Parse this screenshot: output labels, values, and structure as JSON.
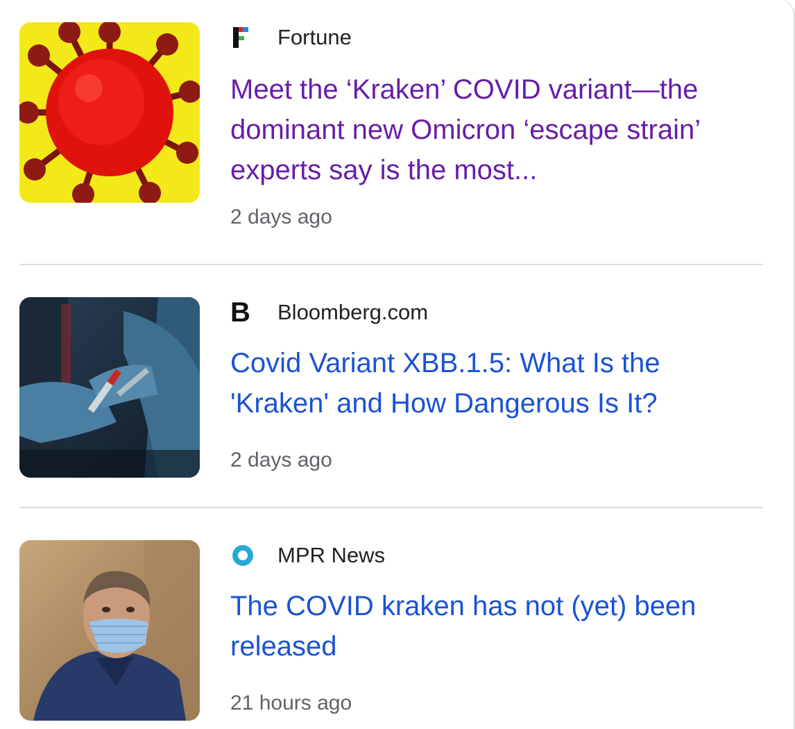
{
  "articles": [
    {
      "source": "Fortune",
      "favicon_icon": "fortune-logo-icon",
      "headline": "Meet the ‘Kraken’ COVID variant—the dominant new Omicron ‘escape strain’ experts say is the most...",
      "time": "2 days ago",
      "visited": true,
      "thumbnail": "coronavirus-illustration"
    },
    {
      "source": "Bloomberg.com",
      "favicon_icon": "bloomberg-logo-icon",
      "favicon_text": "B",
      "headline": "Covid Variant XBB.1.5: What Is the 'Kraken' and How Dangerous Is It?",
      "time": "2 days ago",
      "visited": false,
      "thumbnail": "lab-gloves-test-tube-photo"
    },
    {
      "source": "MPR News",
      "favicon_icon": "mpr-news-logo-icon",
      "headline": "The COVID kraken has not (yet) been released",
      "time": "21 hours ago",
      "visited": false,
      "thumbnail": "masked-health-worker-photo"
    }
  ],
  "colors": {
    "visited_link": "#681da8",
    "unvisited_link": "#1a52d4",
    "meta_text": "#5f6368",
    "divider": "#dadce0"
  }
}
